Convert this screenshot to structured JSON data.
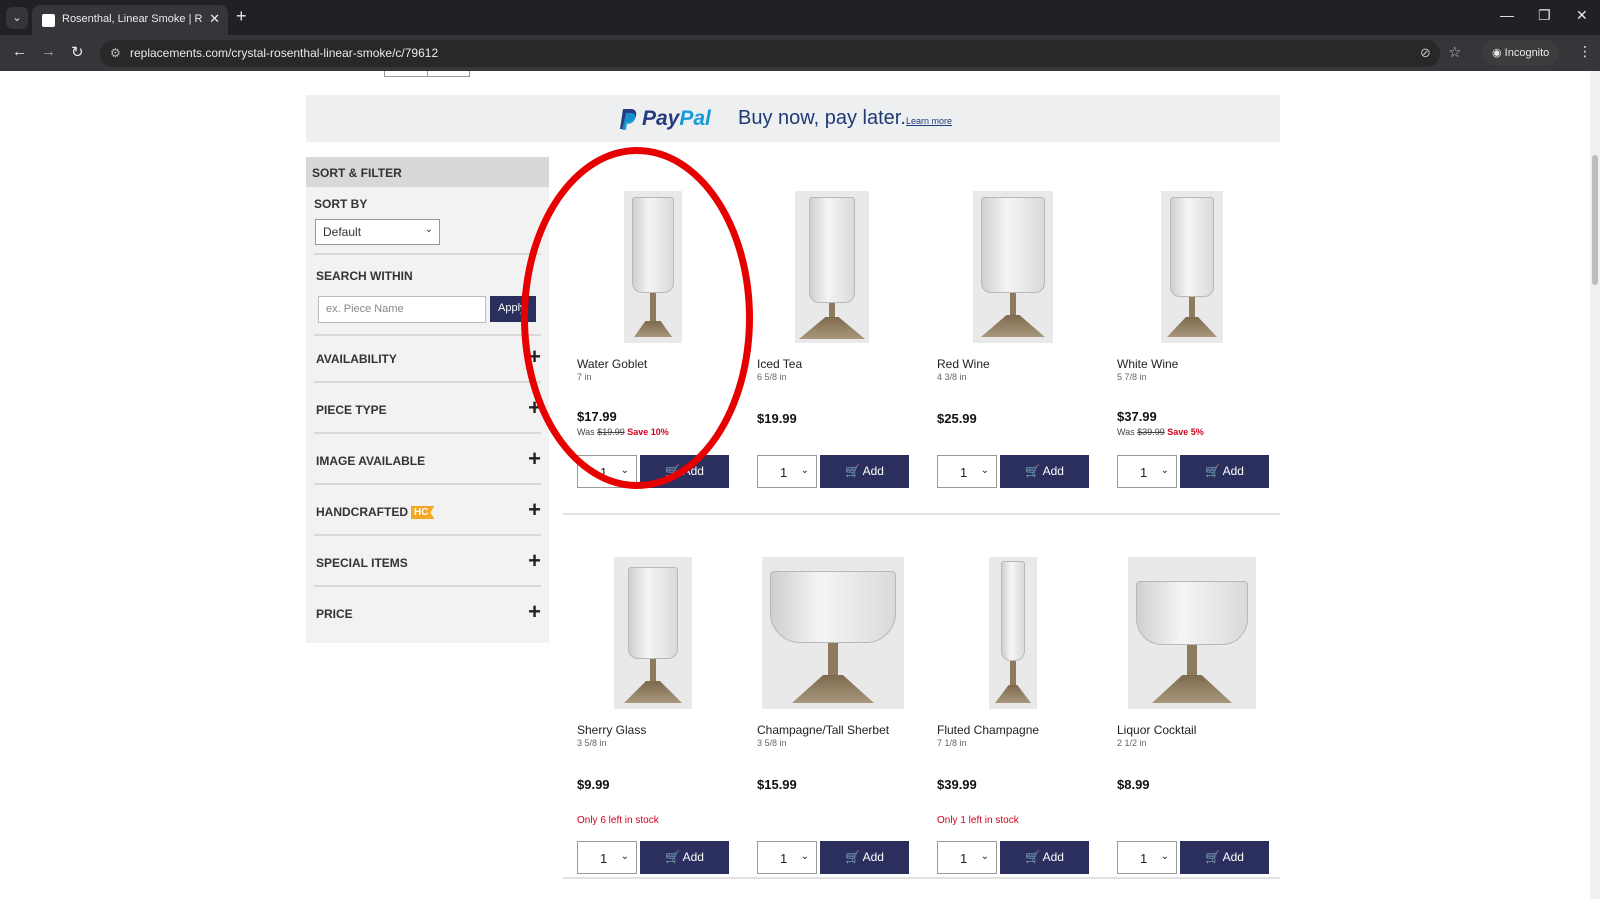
{
  "browser": {
    "tab_title": "Rosenthal, Linear Smoke | Repl",
    "tab_close": "✕",
    "new_tab": "+",
    "url": "replacements.com/crystal-rosenthal-linear-smoke/c/79612",
    "incognito_label": "Incognito",
    "icons": [
      "tab-list-icon",
      "back-icon",
      "forward-icon",
      "reload-icon",
      "site-info-icon",
      "eye-off-icon",
      "star-icon",
      "incognito-icon",
      "menu-icon",
      "minimize-icon",
      "restore-icon",
      "close-icon"
    ]
  },
  "banner": {
    "paypal_word1": "Pay",
    "paypal_word2": "Pal",
    "tagline": "Buy now, pay later.",
    "learn_more": "Learn more"
  },
  "sidebar": {
    "header": "SORT & FILTER",
    "sort_by_label": "SORT BY",
    "sort_value": "Default",
    "search_within_label": "SEARCH WITHIN",
    "search_placeholder": "ex. Piece Name",
    "apply_label": "Apply",
    "facets": [
      {
        "label": "AVAILABILITY"
      },
      {
        "label": "PIECE TYPE"
      },
      {
        "label": "IMAGE AVAILABLE"
      },
      {
        "label": "HANDCRAFTED",
        "badge": "HC"
      },
      {
        "label": "SPECIAL ITEMS"
      },
      {
        "label": "PRICE"
      }
    ]
  },
  "products": [
    {
      "name": "Water Goblet",
      "size": "7 in",
      "price": "$17.99",
      "was": "$19.99",
      "save": "Save 10%",
      "qty": "1",
      "add": "Add"
    },
    {
      "name": "Iced Tea",
      "size": "6 5/8 in",
      "price": "$19.99",
      "qty": "1",
      "add": "Add"
    },
    {
      "name": "Red Wine",
      "size": "4 3/8 in",
      "price": "$25.99",
      "qty": "1",
      "add": "Add"
    },
    {
      "name": "White Wine",
      "size": "5 7/8 in",
      "price": "$37.99",
      "was": "$39.99",
      "save": "Save 5%",
      "qty": "1",
      "add": "Add"
    },
    {
      "name": "Sherry Glass",
      "size": "3 5/8 in",
      "price": "$9.99",
      "stock": "Only 6 left in stock",
      "qty": "1",
      "add": "Add"
    },
    {
      "name": "Champagne/Tall Sherbet",
      "size": "3 5/8 in",
      "price": "$15.99",
      "qty": "1",
      "add": "Add"
    },
    {
      "name": "Fluted Champagne",
      "size": "7 1/8 in",
      "price": "$39.99",
      "stock": "Only 1 left in stock",
      "qty": "1",
      "add": "Add"
    },
    {
      "name": "Liquor Cocktail",
      "size": "2 1/2 in",
      "price": "$8.99",
      "qty": "1",
      "add": "Add"
    }
  ],
  "was_prefix": "Was",
  "annotation_color": "#e60000",
  "accent_color": "#2b2f5e"
}
